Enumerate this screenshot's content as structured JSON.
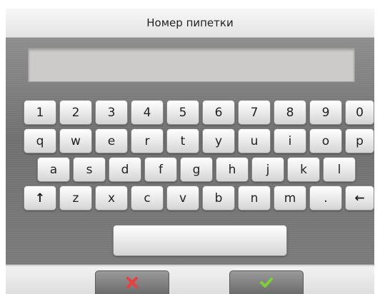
{
  "title": "Номер пипетки",
  "entry": {
    "value": ""
  },
  "keyboard": {
    "row1": [
      "1",
      "2",
      "3",
      "4",
      "5",
      "6",
      "7",
      "8",
      "9",
      "0"
    ],
    "row2": [
      "q",
      "w",
      "e",
      "r",
      "t",
      "y",
      "u",
      "i",
      "o",
      "p"
    ],
    "row3": [
      "a",
      "s",
      "d",
      "f",
      "g",
      "h",
      "j",
      "k",
      "l"
    ],
    "row4": [
      "↑",
      "z",
      "x",
      "c",
      "v",
      "b",
      "n",
      "m",
      ".",
      "←"
    ],
    "space": ""
  },
  "actions": {
    "cancel_icon": "red-x-icon",
    "confirm_icon": "green-check-icon"
  },
  "colors": {
    "cancel": "#e8403f",
    "confirm": "#7dd135",
    "panel": "#7a7a7a",
    "field": "#cdcaca"
  }
}
